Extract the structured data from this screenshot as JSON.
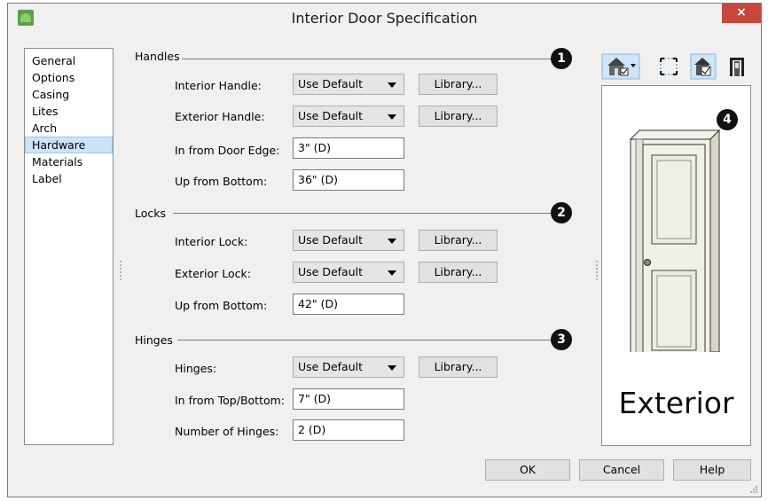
{
  "window": {
    "title": "Interior Door Specification",
    "close_glyph": "×",
    "icon": "app-icon"
  },
  "nav": {
    "items": [
      {
        "label": "General"
      },
      {
        "label": "Options"
      },
      {
        "label": "Casing"
      },
      {
        "label": "Lites"
      },
      {
        "label": "Arch"
      },
      {
        "label": "Hardware",
        "selected": true
      },
      {
        "label": "Materials"
      },
      {
        "label": "Label"
      }
    ]
  },
  "handles": {
    "heading": "Handles",
    "badge": "1",
    "interior_label": "Interior Handle:",
    "interior_value": "Use Default",
    "exterior_label": "Exterior Handle:",
    "exterior_value": "Use Default",
    "edge_label": "In from Door Edge:",
    "edge_value": "3\" (D)",
    "bottom_label": "Up from Bottom:",
    "bottom_value": "36\" (D)"
  },
  "locks": {
    "heading": "Locks",
    "badge": "2",
    "interior_label": "Interior Lock:",
    "interior_value": "Use Default",
    "exterior_label": "Exterior Lock:",
    "exterior_value": "Use Default",
    "bottom_label": "Up from Bottom:",
    "bottom_value": "42\" (D)"
  },
  "hinges": {
    "heading": "Hinges",
    "badge": "3",
    "hinges_label": "Hinges:",
    "hinges_value": "Use Default",
    "topbottom_label": "In from Top/Bottom:",
    "topbottom_value": "7\" (D)",
    "count_label": "Number of Hinges:",
    "count_value": "2 (D)"
  },
  "library_label": "Library...",
  "preview": {
    "badge": "4",
    "caption": "Exterior"
  },
  "footer": {
    "ok": "OK",
    "cancel": "Cancel",
    "help": "Help"
  },
  "colors": {
    "close": "#c7463e",
    "selection": "#cce4f7",
    "door": "#f1f0e6"
  }
}
